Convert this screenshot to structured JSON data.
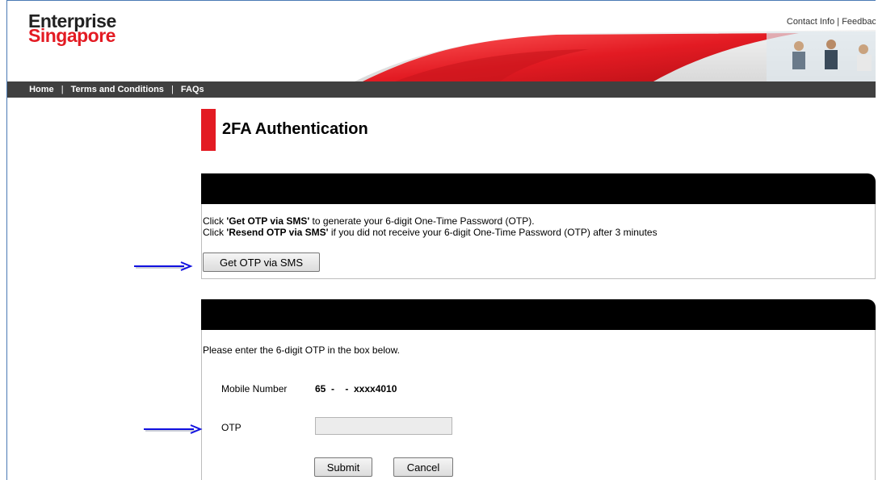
{
  "header": {
    "logo_line1": "Enterprise",
    "logo_line2": "Singapore",
    "contact_info": "Contact Info",
    "separator": "|",
    "feedback": "Feedbac"
  },
  "nav": {
    "home": "Home",
    "terms": "Terms and Conditions",
    "faqs": "FAQs",
    "sep": "|"
  },
  "page": {
    "title": "2FA Authentication"
  },
  "otp_request": {
    "line1_prefix": "Click ",
    "line1_bold": "'Get OTP via SMS'",
    "line1_suffix": " to generate your 6-digit One-Time Password (OTP).",
    "line2_prefix": "Click ",
    "line2_bold": "'Resend OTP via SMS'",
    "line2_suffix": " if you did not receive your 6-digit One-Time Password (OTP) after 3 minutes",
    "get_otp_button": "Get OTP via SMS"
  },
  "otp_entry": {
    "instruction": "Please enter the 6-digit OTP in the box below.",
    "mobile_label": "Mobile Number",
    "mobile_value": "65  -    -  xxxx4010",
    "otp_label": "OTP",
    "otp_value": "",
    "submit_button": "Submit",
    "cancel_button": "Cancel"
  },
  "colors": {
    "brand_red": "#e31b23",
    "nav_bg": "#404040",
    "section_header": "#000000",
    "annotation_arrow": "#1010e0"
  },
  "annotations": {
    "arrow_icon": "right-arrow-icon"
  }
}
